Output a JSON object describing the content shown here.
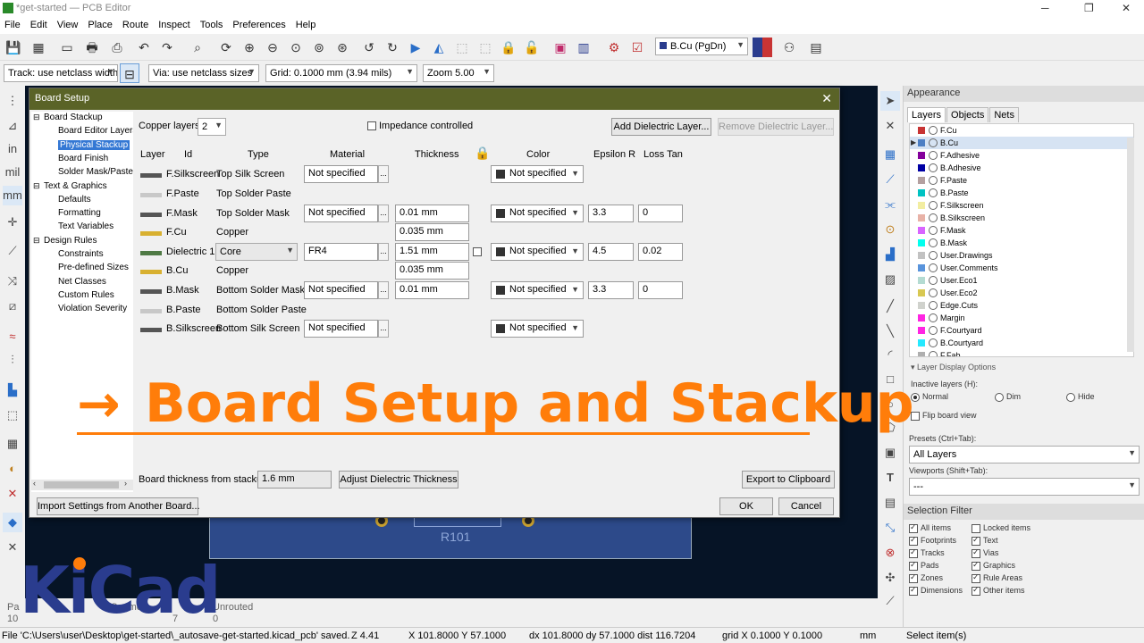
{
  "window": {
    "title": "*get-started — PCB Editor"
  },
  "menu": [
    "File",
    "Edit",
    "View",
    "Place",
    "Route",
    "Inspect",
    "Tools",
    "Preferences",
    "Help"
  ],
  "aux": {
    "track": "Track: use netclass width",
    "via": "Via: use netclass sizes",
    "grid": "Grid: 0.1000 mm (3.94 mils)",
    "zoom": "Zoom 5.00",
    "layer": "B.Cu (PgDn)"
  },
  "canvas": {
    "ref": "R101"
  },
  "dialog": {
    "title": "Board Setup",
    "tree": [
      {
        "label": "Board Stackup",
        "level": 0
      },
      {
        "label": "Board Editor Layers",
        "level": 1
      },
      {
        "label": "Physical Stackup",
        "level": 1,
        "selected": true
      },
      {
        "label": "Board Finish",
        "level": 1
      },
      {
        "label": "Solder Mask/Paste",
        "level": 1
      },
      {
        "label": "Text & Graphics",
        "level": 0
      },
      {
        "label": "Defaults",
        "level": 1
      },
      {
        "label": "Formatting",
        "level": 1
      },
      {
        "label": "Text Variables",
        "level": 1
      },
      {
        "label": "Design Rules",
        "level": 0
      },
      {
        "label": "Constraints",
        "level": 1
      },
      {
        "label": "Pre-defined Sizes",
        "level": 1
      },
      {
        "label": "Net Classes",
        "level": 1
      },
      {
        "label": "Custom Rules",
        "level": 1
      },
      {
        "label": "Violation Severity",
        "level": 1
      }
    ],
    "copper_layers_label": "Copper layers:",
    "copper_layers_value": "2",
    "impedance_label": "Impedance controlled",
    "add_dielectric": "Add Dielectric Layer...",
    "remove_dielectric": "Remove Dielectric Layer...",
    "headers": {
      "layer": "Layer",
      "id": "Id",
      "type": "Type",
      "material": "Material",
      "thickness": "Thickness",
      "color": "Color",
      "epsilon": "Epsilon R",
      "loss": "Loss Tan"
    },
    "rows": [
      {
        "swatch": "#555555",
        "id": "F.Silkscreen",
        "type": "Top Silk Screen",
        "material": "Not specified",
        "thickness": "",
        "color": "Not specified",
        "epsilon": "",
        "loss": ""
      },
      {
        "swatch": "#c8c8c8",
        "id": "F.Paste",
        "type": "Top Solder Paste",
        "material": "",
        "thickness": "",
        "color": "",
        "epsilon": "",
        "loss": ""
      },
      {
        "swatch": "#555555",
        "id": "F.Mask",
        "type": "Top Solder Mask",
        "material": "Not specified",
        "thickness": "0.01 mm",
        "color": "Not specified",
        "epsilon": "3.3",
        "loss": "0"
      },
      {
        "swatch": "#d8b030",
        "id": "F.Cu",
        "type": "Copper",
        "material": "",
        "thickness": "0.035 mm",
        "color": "",
        "epsilon": "",
        "loss": ""
      },
      {
        "swatch": "#4f7a45",
        "id": "Dielectric 1",
        "type": "Core",
        "material": "FR4",
        "thickness": "1.51 mm",
        "color": "Not specified",
        "epsilon": "4.5",
        "loss": "0.02"
      },
      {
        "swatch": "#d8b030",
        "id": "B.Cu",
        "type": "Copper",
        "material": "",
        "thickness": "0.035 mm",
        "color": "",
        "epsilon": "",
        "loss": ""
      },
      {
        "swatch": "#555555",
        "id": "B.Mask",
        "type": "Bottom Solder Mask",
        "material": "Not specified",
        "thickness": "0.01 mm",
        "color": "Not specified",
        "epsilon": "3.3",
        "loss": "0"
      },
      {
        "swatch": "#c8c8c8",
        "id": "B.Paste",
        "type": "Bottom Solder Paste",
        "material": "",
        "thickness": "",
        "color": "",
        "epsilon": "",
        "loss": ""
      },
      {
        "swatch": "#555555",
        "id": "B.Silkscreen",
        "type": "Bottom Silk Screen",
        "material": "Not specified",
        "thickness": "",
        "color": "Not specified",
        "epsilon": "",
        "loss": ""
      }
    ],
    "board_thickness_label": "Board thickness from stackup:",
    "board_thickness_value": "1.6 mm",
    "adjust_btn": "Adjust Dielectric Thickness",
    "export_btn": "Export to Clipboard",
    "import_btn": "Import Settings from Another Board...",
    "ok": "OK",
    "cancel": "Cancel"
  },
  "overlay": {
    "arrow": "→",
    "text": "Board Setup and Stackup"
  },
  "appearance": {
    "title": "Appearance",
    "tabs": [
      "Layers",
      "Objects",
      "Nets"
    ],
    "layers": [
      {
        "name": "F.Cu",
        "color": "#c83434"
      },
      {
        "name": "B.Cu",
        "color": "#4d7fc4",
        "active": true
      },
      {
        "name": "F.Adhesive",
        "color": "#84009b"
      },
      {
        "name": "B.Adhesive",
        "color": "#0000a4"
      },
      {
        "name": "F.Paste",
        "color": "#b4a0a0"
      },
      {
        "name": "B.Paste",
        "color": "#00c2c2"
      },
      {
        "name": "F.Silkscreen",
        "color": "#f2eda1"
      },
      {
        "name": "B.Silkscreen",
        "color": "#e8b2a7"
      },
      {
        "name": "F.Mask",
        "color": "#d864ff"
      },
      {
        "name": "B.Mask",
        "color": "#02ffee"
      },
      {
        "name": "User.Drawings",
        "color": "#c2c2c2"
      },
      {
        "name": "User.Comments",
        "color": "#5994dc"
      },
      {
        "name": "User.Eco1",
        "color": "#b4dbd2"
      },
      {
        "name": "User.Eco2",
        "color": "#d8c852"
      },
      {
        "name": "Edge.Cuts",
        "color": "#d0d2cd"
      },
      {
        "name": "Margin",
        "color": "#ff26e2"
      },
      {
        "name": "F.Courtyard",
        "color": "#ff26e2"
      },
      {
        "name": "B.Courtyard",
        "color": "#26e9ff"
      },
      {
        "name": "F.Fab",
        "color": "#afafaf"
      }
    ],
    "display_options": "Layer Display Options",
    "inactive_label": "Inactive layers (H):",
    "radios": [
      "Normal",
      "Dim",
      "Hide"
    ],
    "flip": "Flip board view",
    "presets_label": "Presets (Ctrl+Tab):",
    "presets_value": "All Layers",
    "viewports_label": "Viewports (Shift+Tab):",
    "viewports_value": "---"
  },
  "selection_filter": {
    "title": "Selection Filter",
    "items": [
      {
        "label": "All items",
        "on": true
      },
      {
        "label": "Locked items",
        "on": false
      },
      {
        "label": "Footprints",
        "on": true
      },
      {
        "label": "Text",
        "on": true
      },
      {
        "label": "Tracks",
        "on": true
      },
      {
        "label": "Vias",
        "on": true
      },
      {
        "label": "Pads",
        "on": true
      },
      {
        "label": "Graphics",
        "on": true
      },
      {
        "label": "Zones",
        "on": true
      },
      {
        "label": "Rule Areas",
        "on": true
      },
      {
        "label": "Dimensions",
        "on": true
      },
      {
        "label": "Other items",
        "on": true
      }
    ]
  },
  "msgpanel": {
    "pads": "Pa",
    "segments": "Segme",
    "unrouted": "Unrouted",
    "v1": "10",
    "v2": "7",
    "v3": "0"
  },
  "status": {
    "file": "File 'C:\\Users\\user\\Desktop\\get-started\\_autosave-get-started.kicad_pcb' saved.",
    "zoom": "Z 4.41",
    "xy": "X 101.8000  Y 57.1000",
    "dxdy": "dx 101.8000  dy 57.1000  dist 116.7204",
    "grid": "grid X 0.1000  Y 0.1000",
    "units": "mm",
    "mode": "Select item(s)"
  },
  "logo": {
    "text": "KiCad"
  }
}
